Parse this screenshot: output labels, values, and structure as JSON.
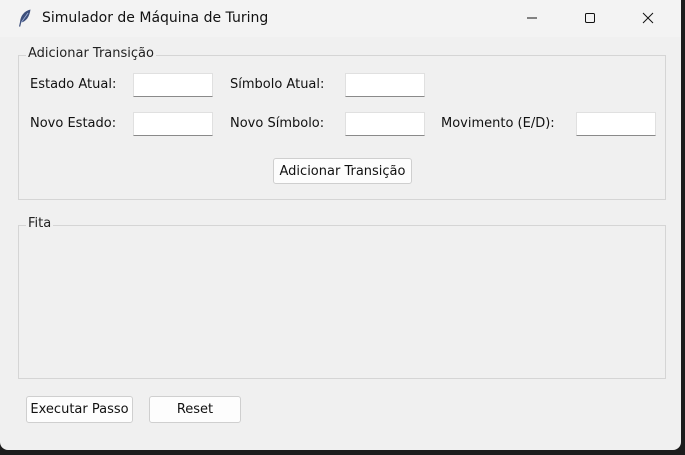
{
  "window": {
    "title": "Simulador de Máquina de Turing",
    "icon": "feather-icon",
    "controls": [
      "minimize-icon",
      "maximize-icon",
      "close-icon"
    ]
  },
  "transition_group": {
    "legend": "Adicionar Transição",
    "fields": {
      "current_state_label": "Estado Atual:",
      "current_state_value": "",
      "current_symbol_label": "Símbolo Atual:",
      "current_symbol_value": "",
      "new_state_label": "Novo Estado:",
      "new_state_value": "",
      "new_symbol_label": "Novo Símbolo:",
      "new_symbol_value": "",
      "move_label": "Movimento (E/D):",
      "move_value": ""
    },
    "add_button": "Adicionar Transição"
  },
  "tape_group": {
    "legend": "Fita"
  },
  "actions": {
    "step_button": "Executar Passo",
    "reset_button": "Reset"
  }
}
